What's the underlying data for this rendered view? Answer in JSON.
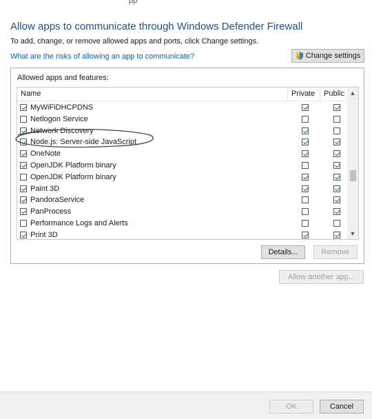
{
  "header": {
    "cropped_text": "pp",
    "title": "Allow apps to communicate through Windows Defender Firewall",
    "subtitle": "To add, change, or remove allowed apps and ports, click Change settings.",
    "risk_link": "What are the risks of allowing an app to communicate?",
    "change_settings": "Change settings",
    "change_settings_icon": "shield-icon"
  },
  "apps": {
    "group_label": "Allowed apps and features:",
    "columns": {
      "name": "Name",
      "private": "Private",
      "public": "Public"
    },
    "rows": [
      {
        "name": "MyWiFiDHCPDNS",
        "enabled": true,
        "private": true,
        "public": true
      },
      {
        "name": "Netlogon Service",
        "enabled": false,
        "private": false,
        "public": false
      },
      {
        "name": "Network Discovery",
        "enabled": true,
        "private": true,
        "public": false
      },
      {
        "name": "Node.js: Server-side JavaScript",
        "enabled": true,
        "private": true,
        "public": true
      },
      {
        "name": "OneNote",
        "enabled": true,
        "private": true,
        "public": true
      },
      {
        "name": "OpenJDK Platform binary",
        "enabled": true,
        "private": false,
        "public": true
      },
      {
        "name": "OpenJDK Platform binary",
        "enabled": false,
        "private": true,
        "public": true
      },
      {
        "name": "Paint 3D",
        "enabled": true,
        "private": true,
        "public": true
      },
      {
        "name": "PandoraService",
        "enabled": true,
        "private": false,
        "public": true
      },
      {
        "name": "PanProcess",
        "enabled": true,
        "private": false,
        "public": true
      },
      {
        "name": "Performance Logs and Alerts",
        "enabled": false,
        "private": false,
        "public": false
      },
      {
        "name": "Print 3D",
        "enabled": true,
        "private": true,
        "public": true
      }
    ],
    "details": "Details...",
    "remove": "Remove",
    "allow_another": "Allow another app..."
  },
  "footer": {
    "ok": "OK",
    "cancel": "Cancel"
  }
}
